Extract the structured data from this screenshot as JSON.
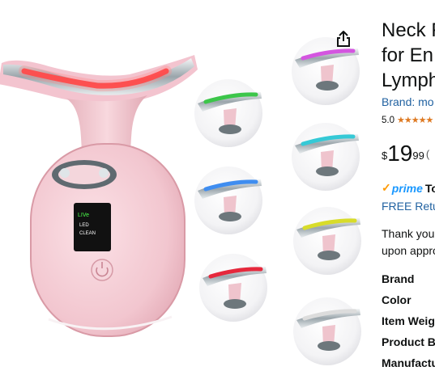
{
  "product": {
    "title_lines": [
      "Neck F",
      "for En",
      "Lymph"
    ],
    "brand_label": "Brand: mo",
    "rating_value": "5.0",
    "stars": "★★★★★",
    "price": {
      "symbol": "$",
      "whole": "19",
      "fraction": "99",
      "extra": "("
    },
    "prime": {
      "check": "✓",
      "word": "prime",
      "extra": "To"
    },
    "returns_label": "FREE Retur",
    "thanks_lines": [
      "Thank you",
      "upon appro"
    ]
  },
  "specs": [
    "Brand",
    "Color",
    "Item Weig",
    "Product B",
    "Manufactu"
  ],
  "device": {
    "screen_lines": [
      "LIVe",
      "LED",
      "CLEAN"
    ]
  },
  "gallery": {
    "light_colors": [
      "#3cc64a",
      "#d455e0",
      "#3f8df0",
      "#35c9d6",
      "#e6283c",
      "#d8dc2a",
      "#c8c8c8"
    ]
  },
  "icons": {
    "share": "share-icon"
  }
}
